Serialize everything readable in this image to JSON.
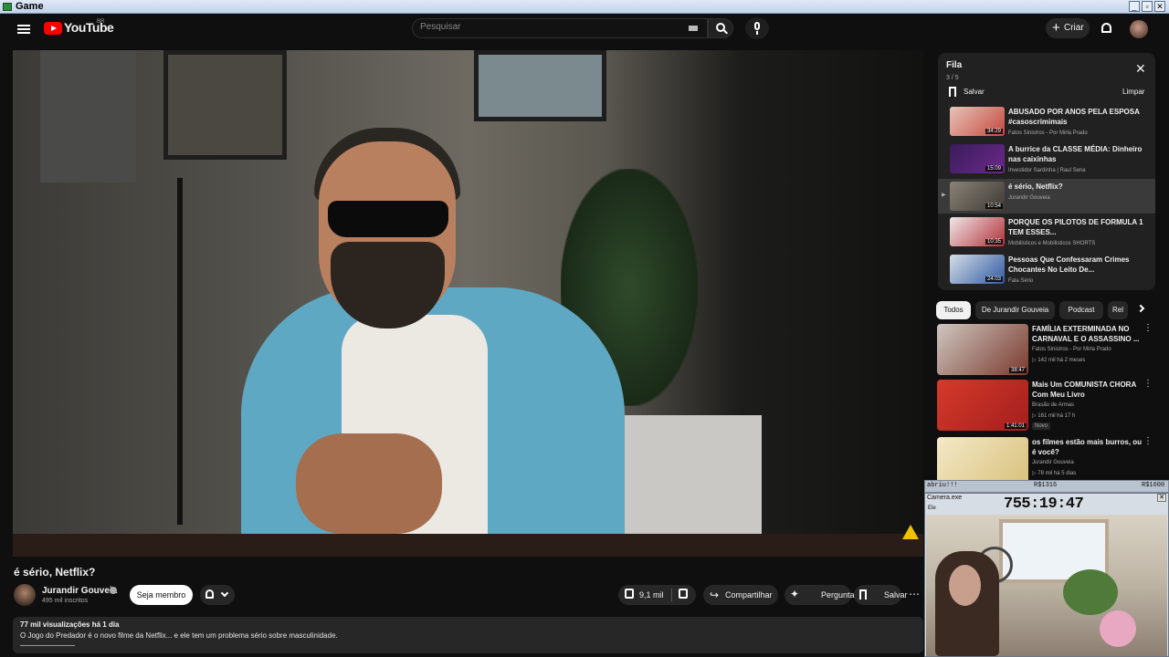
{
  "window": {
    "title": "Game",
    "controls": [
      "_",
      "▫",
      "✕"
    ]
  },
  "header": {
    "logo_text": "YouTube",
    "country": "BR",
    "search_placeholder": "Pesquisar",
    "create_label": "Criar",
    "create_symbol": "+"
  },
  "video": {
    "title": "é sério, Netflix?",
    "channel": "Jurandir Gouveia",
    "subscribers": "495 mil inscritos",
    "member_label": "Seja membro",
    "likes": "9,1 mil",
    "share_label": "Compartilhar",
    "ask_label": "Perguntar",
    "save_label": "Salvar",
    "more_symbol": "⋯",
    "share_symbol": "↪",
    "ask_symbol": "✦",
    "description_stats": "77 mil visualizações  há 1 dia",
    "description_text": "O Jogo do Predador é o novo filme da Netflix... e ele tem um problema sério sobre masculinidade."
  },
  "queue": {
    "title": "Fila",
    "count": "3 / 5",
    "save_label": "Salvar",
    "clear_label": "Limpar",
    "close_symbol": "✕",
    "items": [
      {
        "title": "ABUSADO POR ANOS PELA ESPOSA #casoscrimimais",
        "channel": "Fatos Sinistros - Por Mirla Prado",
        "duration": "34:29",
        "thumb_color": "#c5483e"
      },
      {
        "title": "A burrice da CLASSE MÉDIA: Dinheiro nas caixinhas",
        "channel": "Investidor Sardinha | Raul Sena",
        "duration": "15:09",
        "thumb_color": "#6b2a8a"
      },
      {
        "title": "é sério, Netflix?",
        "channel": "Jurandir Gouveia",
        "duration": "10:54",
        "thumb_color": "#3d3a35",
        "playing_symbol": "▶"
      },
      {
        "title": "PORQUE OS PILOTOS DE FORMULA 1 TEM ESSES...",
        "channel": "Mobilisticos e Mobilisticos SHORTS",
        "duration": "10:35",
        "thumb_color": "#b03038"
      },
      {
        "title": "Pessoas Que Confessaram Crimes Chocantes No Leito De...",
        "channel": "Fala Sério",
        "duration": "24:03",
        "thumb_color": "#2f5aa0"
      }
    ]
  },
  "chips": [
    "Todos",
    "De Jurandir Gouveia",
    "Podcast",
    "Rel"
  ],
  "recommendations": [
    {
      "title": "FAMÍLIA EXTERMINADA NO CARNAVAL E O ASSASSINO ...",
      "channel": "Fatos Sinistros - Por Mirla Prado",
      "meta": "▷ 142 mil  há 2 meses",
      "duration": "38:47",
      "thumb_color": "#7b3a2e"
    },
    {
      "title": "Mais Um COMUNISTA CHORA Com Meu Livro",
      "channel": "Brasão de Armas",
      "meta": "▷ 161 mil  há 17 h",
      "badge": "Novo",
      "duration": "1:41:01",
      "thumb_color": "#a31e1e"
    },
    {
      "title": "os filmes estão mais burros, ou é você?",
      "channel": "Jurandir Gouveia",
      "meta": "▷ 78 mil  há 5 dias",
      "duration": "",
      "thumb_color": "#d8c07a"
    }
  ],
  "camera_overlay": {
    "label": "abriu!!!",
    "value1": "R$1316",
    "value2": "R$1600",
    "window_title": "Camera.exe",
    "timer": "755:19:47",
    "menu": "Ele",
    "close_symbol": "✕"
  },
  "colors": {
    "background": "#0f0f0f",
    "brand_red": "#ff0000",
    "warning": "#f2c200"
  }
}
